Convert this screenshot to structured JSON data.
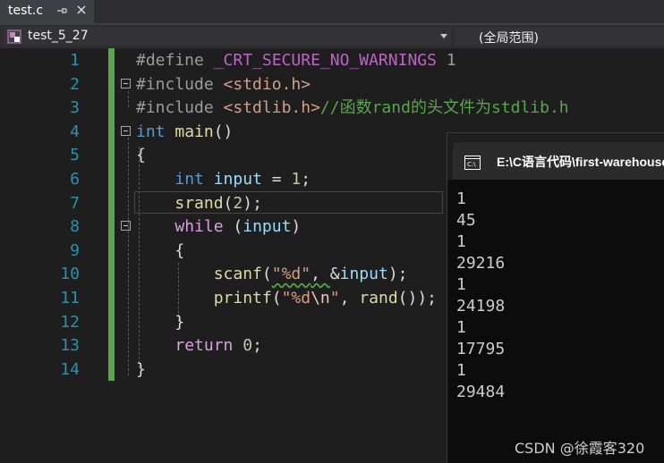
{
  "tab": {
    "filename": "test.c"
  },
  "navbar": {
    "scope": "test_5_27",
    "global": "(全局范围)"
  },
  "editor": {
    "line_numbers": [
      "1",
      "2",
      "3",
      "4",
      "5",
      "6",
      "7",
      "8",
      "9",
      "10",
      "11",
      "12",
      "13",
      "14"
    ],
    "lines": [
      [
        [
          "pp",
          "#define "
        ],
        [
          "mac",
          "_CRT_SECURE_NO_WARNINGS"
        ],
        [
          "pp",
          " 1"
        ]
      ],
      [
        [
          "pp",
          "#include "
        ],
        [
          "str",
          "<stdio.h>"
        ]
      ],
      [
        [
          "pp",
          "#include "
        ],
        [
          "str",
          "<stdlib.h>"
        ],
        [
          "cmt",
          "//函数rand的头文件为stdlib.h"
        ]
      ],
      [
        [
          "kw",
          "int"
        ],
        [
          "pl",
          " "
        ],
        [
          "fn",
          "main"
        ],
        [
          "pl",
          "()"
        ]
      ],
      [
        [
          "pl",
          "{"
        ]
      ],
      [
        [
          "pl",
          "    "
        ],
        [
          "kw",
          "int"
        ],
        [
          "pl",
          " "
        ],
        [
          "var",
          "input"
        ],
        [
          "pl",
          " = "
        ],
        [
          "num",
          "1"
        ],
        [
          "pl",
          ";"
        ]
      ],
      [
        [
          "pl",
          "    "
        ],
        [
          "fn",
          "srand"
        ],
        [
          "pl",
          "("
        ],
        [
          "num",
          "2"
        ],
        [
          "pl",
          ");"
        ]
      ],
      [
        [
          "pl",
          "    "
        ],
        [
          "ctrl",
          "while"
        ],
        [
          "pl",
          " ("
        ],
        [
          "var",
          "input"
        ],
        [
          "pl",
          ")"
        ]
      ],
      [
        [
          "pl",
          "    {"
        ]
      ],
      [
        [
          "pl",
          "        "
        ],
        [
          "fn",
          "scanf"
        ],
        [
          "pl",
          "("
        ],
        [
          "str squiggle",
          "\"%d\""
        ],
        [
          "pl squiggle",
          ", "
        ],
        [
          "pl",
          "&"
        ],
        [
          "var",
          "input"
        ],
        [
          "pl",
          ");"
        ]
      ],
      [
        [
          "pl",
          "        "
        ],
        [
          "fn",
          "printf"
        ],
        [
          "pl",
          "("
        ],
        [
          "str",
          "\"%d"
        ],
        [
          "esc",
          "\\n"
        ],
        [
          "str",
          "\""
        ],
        [
          "pl",
          ", "
        ],
        [
          "fn",
          "rand"
        ],
        [
          "pl",
          "());"
        ]
      ],
      [
        [
          "pl",
          "    }"
        ]
      ],
      [
        [
          "pl",
          "    "
        ],
        [
          "ctrl",
          "return"
        ],
        [
          "pl",
          " "
        ],
        [
          "num",
          "0"
        ],
        [
          "pl",
          ";"
        ]
      ],
      [
        [
          "pl",
          "}"
        ]
      ]
    ]
  },
  "console": {
    "title": "E:\\C语言代码\\first-warehouse",
    "output": [
      "1",
      "45",
      "1",
      "29216",
      "1",
      "24198",
      "1",
      "17795",
      "1",
      "29484"
    ]
  },
  "watermark": "CSDN @徐霞客320"
}
